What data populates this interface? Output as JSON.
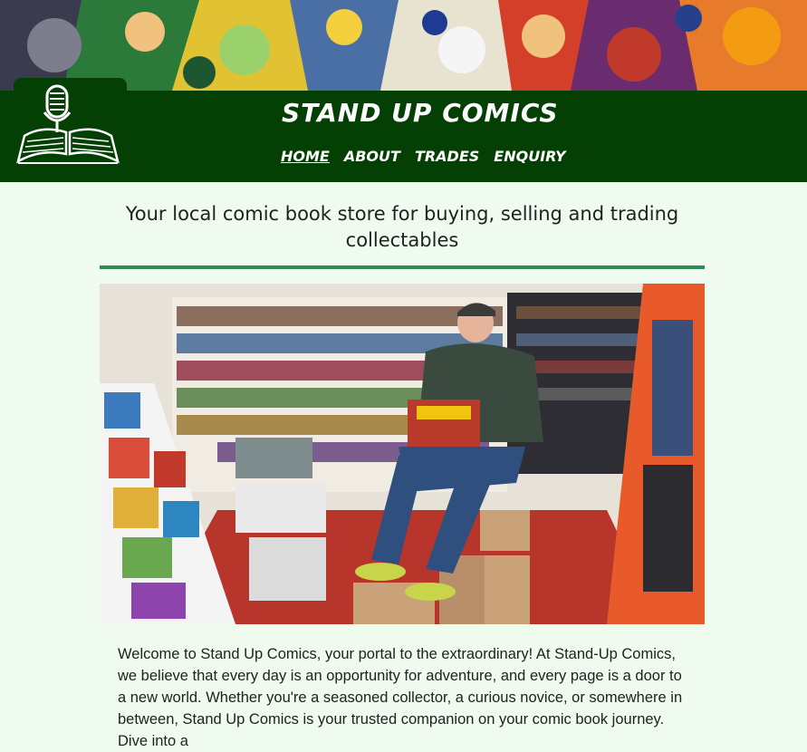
{
  "header": {
    "site_title": "STAND UP COMICS",
    "nav": [
      {
        "label": "HOME",
        "active": true
      },
      {
        "label": "ABOUT",
        "active": false
      },
      {
        "label": "TRADES",
        "active": false
      },
      {
        "label": "ENQUIRY",
        "active": false
      }
    ]
  },
  "main": {
    "tagline": "Your local comic book store for buying, selling and trading collectables",
    "intro": "Welcome to Stand Up Comics, your portal to the extraordinary! At Stand-Up Comics, we believe that every day is an opportunity for adventure, and every page is a door to a new world. Whether you're a seasoned collector, a curious novice, or somewhere in between, Stand Up Comics is your trusted companion on your comic book journey. Dive into a"
  },
  "images": {
    "banner": "comic-collage-banner",
    "logo": "microphone-book-logo-icon",
    "hero": "store-owner-photo"
  },
  "colors": {
    "header_bg": "#043f04",
    "page_bg": "#eefbee",
    "rule": "#2e8b57"
  }
}
